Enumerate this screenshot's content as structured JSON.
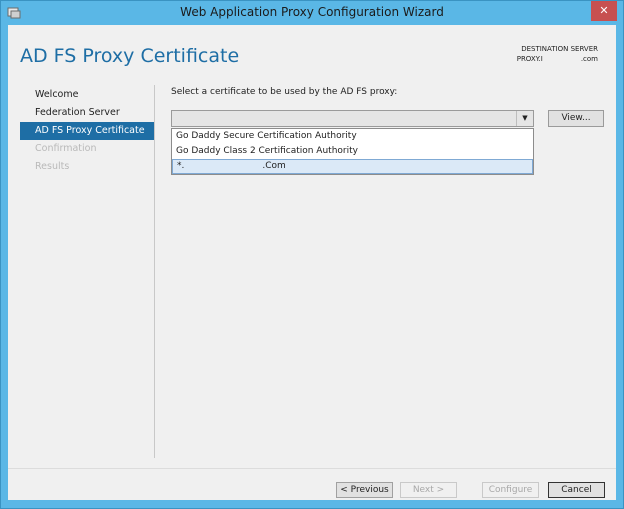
{
  "window": {
    "title": "Web Application Proxy Configuration Wizard",
    "close_label": "✕"
  },
  "header": {
    "page_title": "AD FS Proxy Certificate",
    "destination_label": "DESTINATION SERVER",
    "destination_value_prefix": "PROXY.I",
    "destination_value_suffix": ".com"
  },
  "nav": {
    "items": [
      {
        "label": "Welcome",
        "state": "normal"
      },
      {
        "label": "Federation Server",
        "state": "normal"
      },
      {
        "label": "AD FS Proxy Certificate",
        "state": "active"
      },
      {
        "label": "Confirmation",
        "state": "disabled"
      },
      {
        "label": "Results",
        "state": "disabled"
      }
    ]
  },
  "main": {
    "prompt": "Select a certificate to be used by the AD FS proxy:",
    "combo_value": "",
    "view_button": "View...",
    "options": [
      "Go Daddy Secure Certification Authority",
      "Go Daddy Class 2 Certification Authority"
    ],
    "selected_option_prefix": "*.",
    "selected_option_suffix": ".Com"
  },
  "footer": {
    "previous": "< Previous",
    "next": "Next >",
    "configure": "Configure",
    "cancel": "Cancel"
  },
  "colors": {
    "titlebar": "#5ab7e6",
    "accent": "#1e6ea5",
    "close": "#c75050"
  }
}
